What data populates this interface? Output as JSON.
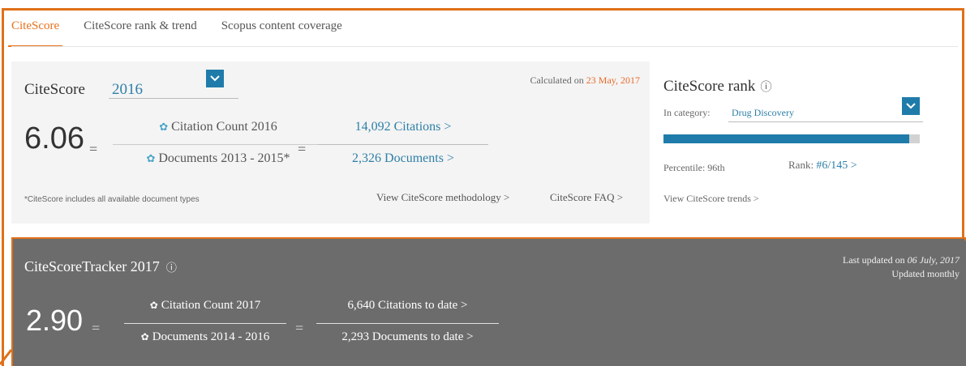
{
  "tabs": [
    {
      "label": "CiteScore",
      "active": true
    },
    {
      "label": "CiteScore rank & trend",
      "active": false
    },
    {
      "label": "Scopus content coverage",
      "active": false
    }
  ],
  "citescore": {
    "title": "CiteScore",
    "year": "2016",
    "calculated_prefix": "Calculated on",
    "calculated_date": "23 May, 2017",
    "score": "6.06",
    "eq": "=",
    "numerator_label": "Citation Count 2016",
    "denominator_label": "Documents 2013 - 2015*",
    "numerator_value": "14,092 Citations >",
    "denominator_value": "2,326 Documents >",
    "footnote": "*CiteScore includes all available document types",
    "methodology_link": "View CiteScore methodology >",
    "faq_link": "CiteScore FAQ >"
  },
  "rank": {
    "title": "CiteScore rank",
    "category_label": "In category:",
    "category_value": "Drug Discovery",
    "percentile_value": 96,
    "percentile_label": "Percentile: 96th",
    "rank_label": "Rank:",
    "rank_value": "#6/145 >",
    "trends_link": "View CiteScore trends >"
  },
  "tracker": {
    "title": "CiteScoreTracker 2017",
    "updated_prefix": "Last updated on",
    "updated_date": "06 July, 2017",
    "updated_freq": "Updated monthly",
    "score": "2.90",
    "eq": "=",
    "numerator_label": "Citation Count 2017",
    "denominator_label": "Documents 2014 - 2016",
    "numerator_value": "6,640 Citations to date >",
    "denominator_value": "2,293 Documents to date >"
  },
  "colors": {
    "accent_orange": "#e9711c",
    "link_blue": "#2e7fa8",
    "dropdown_blue": "#1f7caa",
    "tracker_gray": "#6c6c6c"
  },
  "icons": {
    "dropdown": "chevron-down-icon",
    "info": "info-icon",
    "gear": "gear-icon"
  }
}
